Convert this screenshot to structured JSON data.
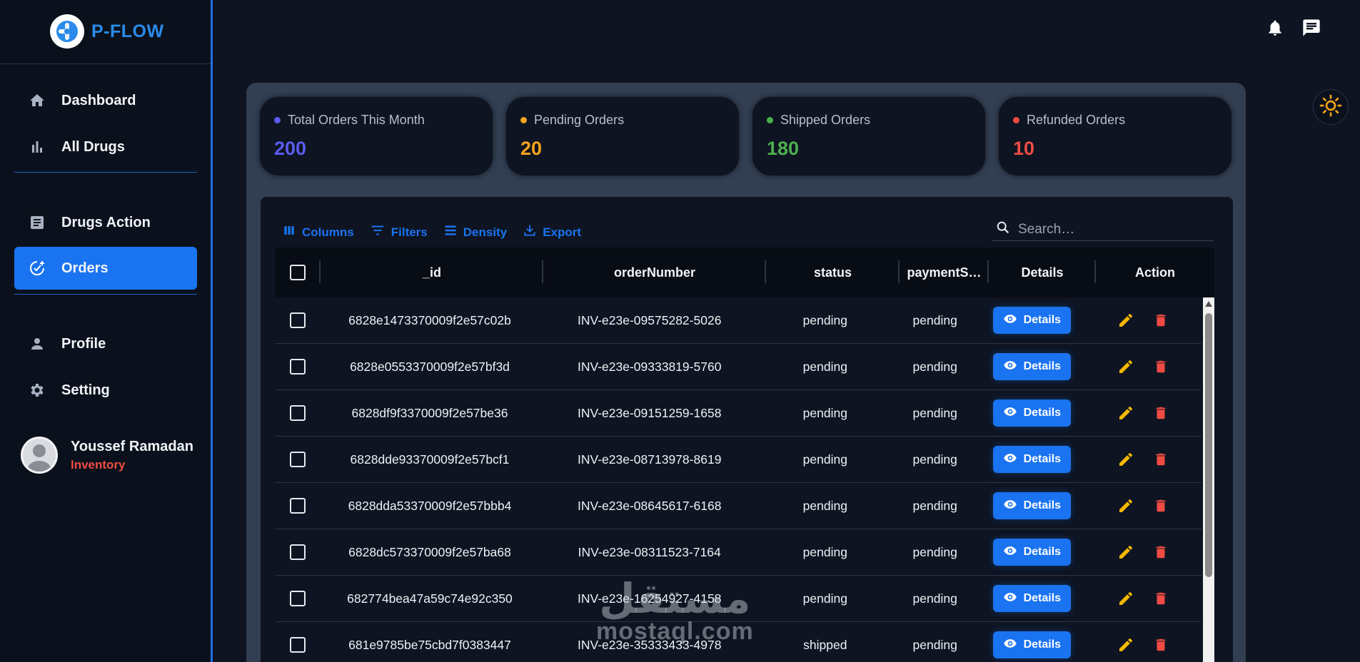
{
  "app": {
    "name": "P-FLOW"
  },
  "sidebar": {
    "items": [
      {
        "label": "Dashboard",
        "icon": "home-icon"
      },
      {
        "label": "All Drugs",
        "icon": "bar-chart-icon"
      },
      {
        "label": "Drugs Action",
        "icon": "document-icon"
      },
      {
        "label": "Orders",
        "icon": "orders-icon",
        "active": true
      },
      {
        "label": "Profile",
        "icon": "person-icon"
      },
      {
        "label": "Setting",
        "icon": "gear-icon"
      }
    ],
    "user": {
      "name": "Youssef Ramadan",
      "role": "Inventory"
    }
  },
  "stats": [
    {
      "label": "Total Orders This Month",
      "value": "200",
      "color": "#5b5bf0"
    },
    {
      "label": "Pending Orders",
      "value": "20",
      "color": "#f5a31a"
    },
    {
      "label": "Shipped Orders",
      "value": "180",
      "color": "#4caf50"
    },
    {
      "label": "Refunded Orders",
      "value": "10",
      "color": "#ef4b43"
    }
  ],
  "toolbar": {
    "columns": "Columns",
    "filters": "Filters",
    "density": "Density",
    "export": "Export",
    "search_placeholder": "Search…"
  },
  "table": {
    "headers": {
      "id": "_id",
      "order": "orderNumber",
      "status": "status",
      "payment": "paymentS…",
      "details": "Details",
      "action": "Action"
    },
    "details_label": "Details",
    "rows": [
      {
        "id": "6828e1473370009f2e57c02b",
        "order": "INV-e23e-09575282-5026",
        "status": "pending",
        "payment": "pending"
      },
      {
        "id": "6828e0553370009f2e57bf3d",
        "order": "INV-e23e-09333819-5760",
        "status": "pending",
        "payment": "pending"
      },
      {
        "id": "6828df9f3370009f2e57be36",
        "order": "INV-e23e-09151259-1658",
        "status": "pending",
        "payment": "pending"
      },
      {
        "id": "6828dde93370009f2e57bcf1",
        "order": "INV-e23e-08713978-8619",
        "status": "pending",
        "payment": "pending"
      },
      {
        "id": "6828dda53370009f2e57bbb4",
        "order": "INV-e23e-08645617-6168",
        "status": "pending",
        "payment": "pending"
      },
      {
        "id": "6828dc573370009f2e57ba68",
        "order": "INV-e23e-08311523-7164",
        "status": "pending",
        "payment": "pending"
      },
      {
        "id": "682774bea47a59c74e92c350",
        "order": "INV-e23e-16254927-4158",
        "status": "pending",
        "payment": "pending"
      },
      {
        "id": "681e9785be75cbd7f0383447",
        "order": "INV-e23e-35333433-4978",
        "status": "shipped",
        "payment": "pending"
      }
    ]
  },
  "watermark": {
    "arabic": "مستقل",
    "latin": "mostaql.com"
  }
}
